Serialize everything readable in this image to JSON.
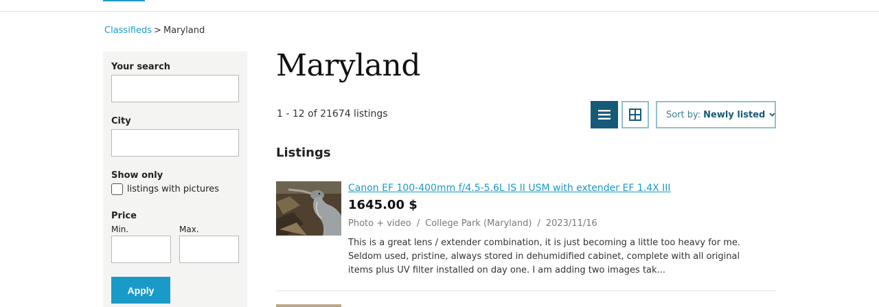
{
  "breadcrumb": {
    "root": "Classifieds",
    "separator": ">",
    "current": "Maryland"
  },
  "sidebar": {
    "search_label": "Your search",
    "search_value": "",
    "city_label": "City",
    "city_value": "",
    "show_only_label": "Show only",
    "pictures_label": "listings with pictures",
    "pictures_checked": false,
    "price_label": "Price",
    "min_label": "Min.",
    "max_label": "Max.",
    "min_value": "",
    "max_value": "",
    "apply_label": "Apply"
  },
  "main": {
    "title": "Maryland",
    "count_text": "1 - 12 of 21674 listings",
    "sort_prefix": "Sort by:",
    "sort_value": "Newly listed",
    "section_title": "Listings",
    "view_mode": "list"
  },
  "listings": [
    {
      "title": "Canon EF 100-400mm f/4.5-5.6L IS II USM with extender EF 1.4X III",
      "price": "1645.00 $",
      "category": "Photo + video",
      "location": "College Park (Maryland)",
      "date": "2023/11/16",
      "description": "This is a great lens / extender combination, it is just becoming a little too heavy for me. Seldom used, pristine, always stored in dehumidified cabinet, complete with all original items plus UV filter installed on day one. I am adding two images tak..."
    }
  ],
  "colors": {
    "accent": "#1a9ac9",
    "dark_accent": "#155a78",
    "sidebar_bg": "#f4f4f2"
  },
  "icons": [
    "list-view-icon",
    "grid-view-icon",
    "chevron-down-icon",
    "heron-photo-thumbnail"
  ]
}
